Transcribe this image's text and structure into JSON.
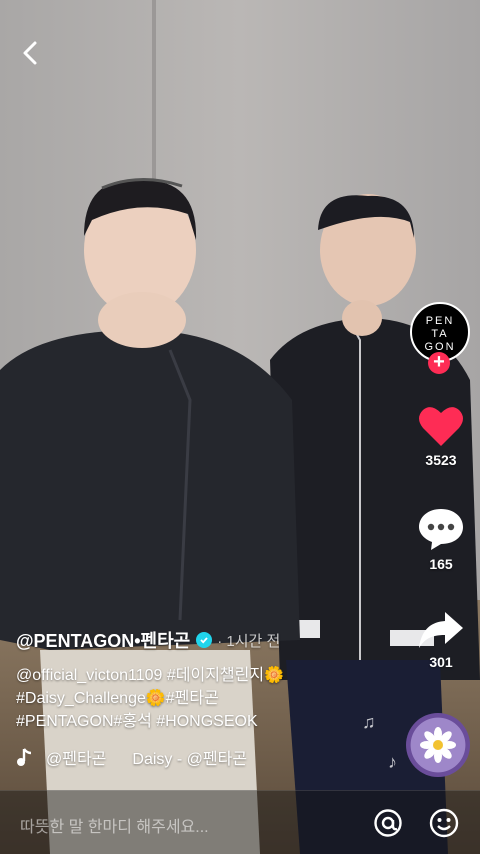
{
  "colors": {
    "like": "#fe2c55",
    "verified": "#20d5ec"
  },
  "nav": {
    "back_icon": "chevron-left-icon"
  },
  "profile": {
    "avatar_text_lines": [
      "PEN",
      "TA",
      "GON"
    ],
    "follow_icon": "plus-icon"
  },
  "actions": {
    "likes": "3523",
    "comments": "165",
    "shares": "301"
  },
  "caption": {
    "author": "@PENTAGON•펜타곤",
    "time": "· 1시간 전",
    "line1": "@official_victon1109 #데이지챌린지🌼",
    "line2": "#Daisy_Challenge🌼#펜타곤",
    "line3": "#PENTAGON#홍석 #HONGSEOK"
  },
  "music": {
    "icon": "music-note-icon",
    "user": "@펜타곤",
    "track": "Daisy - @펜타곤"
  },
  "comment_bar": {
    "placeholder": "따뜻한 말 한마디 해주세요...",
    "at_icon": "at-icon",
    "emoji_icon": "smiley-icon"
  }
}
